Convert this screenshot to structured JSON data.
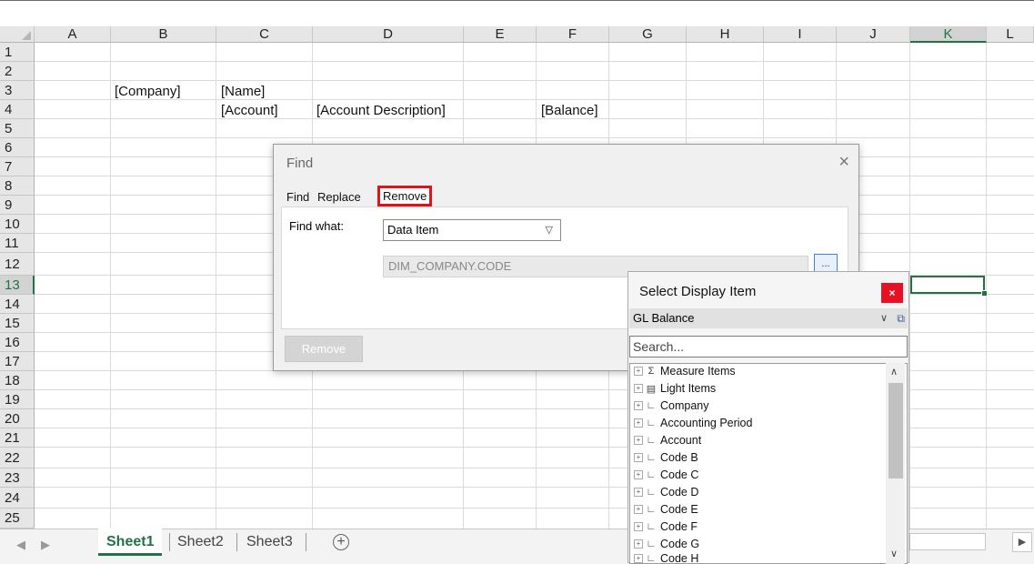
{
  "columns": [
    "A",
    "B",
    "C",
    "D",
    "E",
    "F",
    "G",
    "H",
    "I",
    "J",
    "K",
    "L"
  ],
  "selected_column": "K",
  "rows": [
    "1",
    "2",
    "3",
    "4",
    "5",
    "6",
    "7",
    "8",
    "9",
    "10",
    "11",
    "12",
    "13",
    "14",
    "15",
    "16",
    "17",
    "18",
    "19",
    "20",
    "21",
    "22",
    "23",
    "24",
    "25"
  ],
  "selected_row": "13",
  "cells": {
    "b3": "[Company]",
    "c3": "[Name]",
    "c4": "[Account]",
    "d4": "[Account Description]",
    "f4": "[Balance]"
  },
  "sheets": [
    "Sheet1",
    "Sheet2",
    "Sheet3"
  ],
  "active_sheet": "Sheet1",
  "add_sheet_icon": "+",
  "find_dialog": {
    "title": "Find",
    "close_icon": "×",
    "tabs": [
      "Find",
      "Replace",
      "Remove"
    ],
    "active_tab": "Remove",
    "find_what_label": "Find what:",
    "find_what_value": "Data Item",
    "item_value": "DIM_COMPANY.CODE",
    "browse_label": "...",
    "remove_button": "Remove"
  },
  "display_item_panel": {
    "title": "Select Display Item",
    "close_icon": "×",
    "source": "GL Balance",
    "search_placeholder": "Search...",
    "tree_items": [
      {
        "icon": "Σ",
        "label": "Measure Items"
      },
      {
        "icon": "▤",
        "label": "Light Items"
      },
      {
        "icon": "∟",
        "label": "Company"
      },
      {
        "icon": "∟",
        "label": "Accounting Period"
      },
      {
        "icon": "∟",
        "label": "Account"
      },
      {
        "icon": "∟",
        "label": "Code B"
      },
      {
        "icon": "∟",
        "label": "Code C"
      },
      {
        "icon": "∟",
        "label": "Code D"
      },
      {
        "icon": "∟",
        "label": "Code E"
      },
      {
        "icon": "∟",
        "label": "Code F"
      },
      {
        "icon": "∟",
        "label": "Code G"
      },
      {
        "icon": "∟",
        "label": "Code H"
      }
    ]
  },
  "colors": {
    "excel_green": "#217346",
    "highlight_red": "#e0131a",
    "close_red": "#e81123"
  }
}
